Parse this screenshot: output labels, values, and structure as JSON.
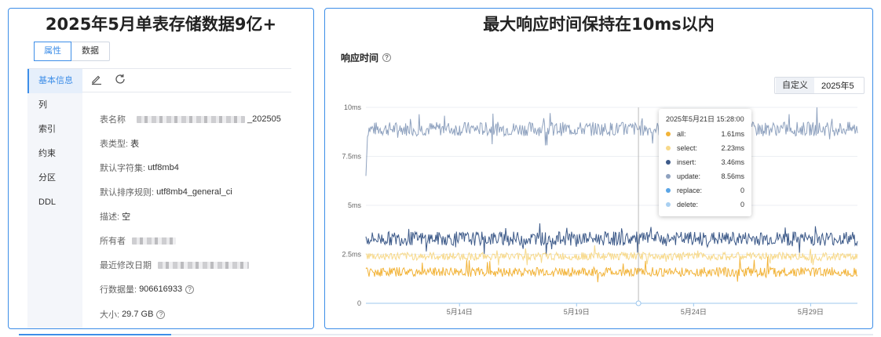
{
  "left": {
    "title": "2025年5月单表存储数据9亿+",
    "tabs": [
      {
        "label": "属性"
      },
      {
        "label": "数据"
      }
    ],
    "nav": [
      {
        "label": "基本信息"
      },
      {
        "label": "列"
      },
      {
        "label": "索引"
      },
      {
        "label": "约束"
      },
      {
        "label": "分区"
      },
      {
        "label": "DDL"
      }
    ],
    "toolbar": {
      "edit_icon": "edit-icon",
      "refresh_icon": "refresh-icon"
    },
    "props": {
      "table_name_label": "表名称",
      "table_name_suffix": "_202505",
      "table_type_label": "表类型:",
      "table_type_value": "表",
      "charset_label": "默认字符集:",
      "charset_value": "utf8mb4",
      "collation_label": "默认排序规则:",
      "collation_value": "utf8mb4_general_ci",
      "desc_label": "描述:",
      "desc_value": "空",
      "owner_label": "所有者",
      "modified_label": "最近修改日期",
      "rows_label": "行数据量:",
      "rows_value": "906616933",
      "size_label": "大小:",
      "size_value": "29.7 GB"
    }
  },
  "right": {
    "title": "最大响应时间保持在10ms以内",
    "subtitle": "响应时间",
    "date_tag": "自定义",
    "date_value": "2025年5",
    "tooltip": {
      "title": "2025年5月21日 15:28:00",
      "rows": [
        {
          "name": "all:",
          "value": "1.61ms",
          "color": "#f2b338"
        },
        {
          "name": "select:",
          "value": "2.23ms",
          "color": "#f7d98a"
        },
        {
          "name": "insert:",
          "value": "3.46ms",
          "color": "#3d5a89"
        },
        {
          "name": "update:",
          "value": "8.56ms",
          "color": "#8fa2bf"
        },
        {
          "name": "replace:",
          "value": "0",
          "color": "#5aa5e6"
        },
        {
          "name": "delete:",
          "value": "0",
          "color": "#a9d0f1"
        }
      ]
    }
  },
  "chart_data": {
    "type": "line",
    "title": "",
    "ylabel": "",
    "xlabel": "",
    "y_ticks": [
      "0",
      "2.5ms",
      "5ms",
      "7.5ms",
      "10ms"
    ],
    "ylim": [
      0,
      10
    ],
    "x_ticks": [
      "5月14日",
      "5月19日",
      "5月24日",
      "5月29日"
    ],
    "x_range": [
      "2025-05-10",
      "2025-05-31"
    ],
    "grid": true,
    "hover_date": "2025-05-21 15:28",
    "series": [
      {
        "name": "update",
        "color": "#8fa2bf",
        "baseline": 8.9,
        "noise": 0.45
      },
      {
        "name": "insert",
        "color": "#3d5a89",
        "baseline": 3.3,
        "noise": 0.45
      },
      {
        "name": "select",
        "color": "#f7d98a",
        "baseline": 2.4,
        "noise": 0.25
      },
      {
        "name": "all",
        "color": "#f2b338",
        "baseline": 1.6,
        "noise": 0.3
      },
      {
        "name": "replace",
        "color": "#5aa5e6",
        "baseline": 0,
        "noise": 0
      },
      {
        "name": "delete",
        "color": "#a9d0f1",
        "baseline": 0,
        "noise": 0
      }
    ]
  }
}
